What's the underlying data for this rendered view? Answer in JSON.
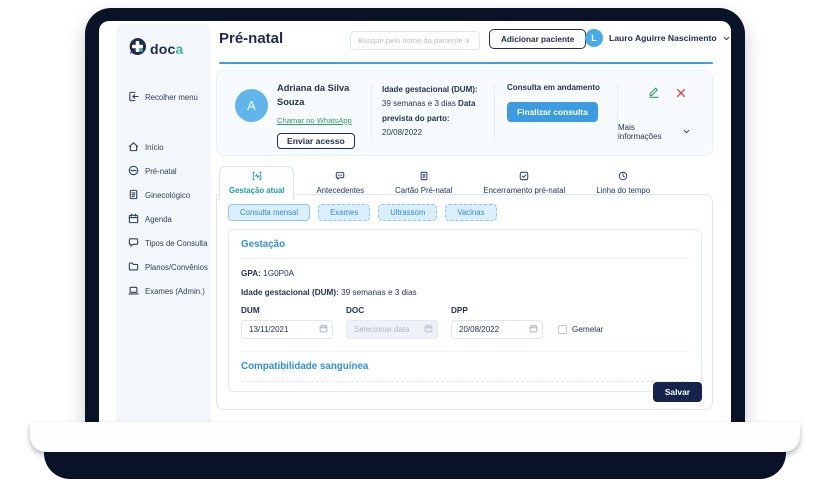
{
  "brand": {
    "logo_primary": "doc",
    "logo_accent": "a"
  },
  "sidebar": {
    "collapse_label": "Recolher menu",
    "items": [
      {
        "label": "Início"
      },
      {
        "label": "Pré-natal"
      },
      {
        "label": "Ginecológico"
      },
      {
        "label": "Agenda"
      },
      {
        "label": "Tipos de Consulta"
      },
      {
        "label": "Planos/Convênios"
      },
      {
        "label": "Exames (Admin.)"
      }
    ]
  },
  "topbar": {
    "title": "Pré-natal",
    "search_placeholder": "Busque pelo nome da paciente ∨",
    "add_button": "Adicionar paciente",
    "user": {
      "initial": "L",
      "name": "Lauro Aguirre Nascimento"
    }
  },
  "patient": {
    "initial": "A",
    "name": "Adriana da Silva Souza",
    "whatsapp_link": "Chamar no WhatsApp",
    "access_button": "Enviar acesso",
    "gestational_age_label": "Idade gestacional (DUM):",
    "gestational_age_value": " 39 semanas e 3 dias ",
    "due_date_label": "Data prevista do parto:",
    "due_date_value": " 20/08/2022",
    "status": "Consulta em andamento",
    "finish_button": "Finalizar consulta",
    "more_info": "Mais informações"
  },
  "tabs": [
    {
      "label": "Gestação atual",
      "active": true
    },
    {
      "label": "Antecedentes",
      "active": false
    },
    {
      "label": "Cartão Pré-natal",
      "active": false
    },
    {
      "label": "Encerramento pré-natal",
      "active": false
    },
    {
      "label": "Linha do tempo",
      "active": false
    }
  ],
  "pills": [
    {
      "label": "Consulta mensal"
    },
    {
      "label": "Exames"
    },
    {
      "label": "Ultrassom"
    },
    {
      "label": "Vacinas"
    }
  ],
  "gestation": {
    "section_title": "Gestação",
    "gpa_label": "GPA:",
    "gpa_value": "  1G0P0A",
    "ig_label": "Idade gestacional (DUM):",
    "ig_value": "  39 semanas e 3 dias",
    "fields": {
      "dum": {
        "label": "DUM",
        "value": "13/11/2021"
      },
      "doc": {
        "label": "DOC",
        "placeholder": "Selecionar data"
      },
      "dpp": {
        "label": "DPP",
        "value": "20/08/2022"
      }
    },
    "twin_label": "Gemelar",
    "blood_section_title": "Compatibilidade sanguínea"
  },
  "actions": {
    "save_label": "Salvar"
  },
  "colors": {
    "navy": "#0a1228",
    "text_navy": "#223452",
    "teal_accent": "#18a09b",
    "blue_accent": "#2e8fd8",
    "button_blue": "#3d9ce1",
    "divider_blue": "#3f9fe0",
    "green_link": "#2e9e68",
    "red_close": "#e14b4b",
    "sidebar_bg": "#f3f7fc",
    "card_bg": "#f8fbfe",
    "pill_bg": "#dbeefb"
  }
}
